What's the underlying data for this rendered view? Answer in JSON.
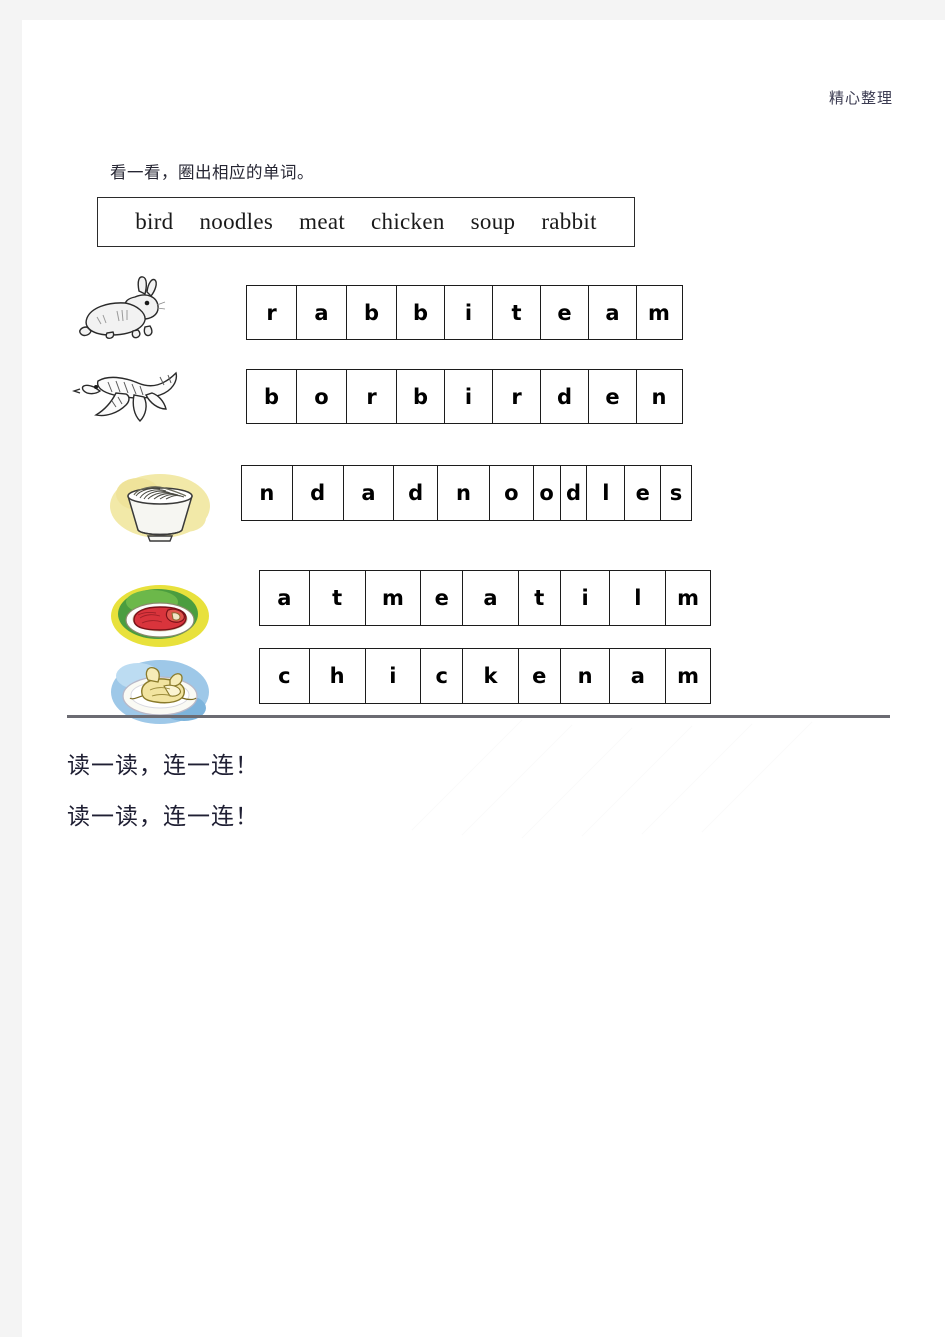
{
  "header": {
    "note": "精心整理"
  },
  "instruction": "看一看，圈出相应的单词。",
  "word_bank": {
    "words": [
      "bird",
      "noodles",
      "meat",
      "chicken",
      "soup",
      "rabbit"
    ]
  },
  "exercises": [
    {
      "picture": "rabbit-picture",
      "answer": "rabbit",
      "letters": [
        "r",
        "a",
        "b",
        "b",
        "i",
        "t",
        "e",
        "a",
        "m"
      ]
    },
    {
      "picture": "bird-picture",
      "answer": "bird",
      "letters": [
        "b",
        "o",
        "r",
        "b",
        "i",
        "r",
        "d",
        "e",
        "n"
      ]
    },
    {
      "picture": "noodles-picture",
      "answer": "noodles",
      "letters": [
        "n",
        "d",
        "a",
        "d",
        "n",
        "o",
        "o",
        "d",
        "l",
        "e",
        "s"
      ]
    },
    {
      "picture": "meat-picture",
      "answer": "meat",
      "letters": [
        "a",
        "t",
        "m",
        "e",
        "a",
        "t",
        "i",
        "l",
        "m"
      ]
    },
    {
      "picture": "chicken-picture",
      "answer": "chicken",
      "letters": [
        "c",
        "h",
        "i",
        "c",
        "k",
        "e",
        "n",
        "a",
        "m"
      ]
    }
  ],
  "prompts": [
    "读一读，连一连！",
    "读一读，连一连！"
  ],
  "colors": {
    "page_background": "#ffffff",
    "outer_background": "#f4f4f4",
    "text": "#1a1a1a",
    "header_note": "#3a3a50",
    "divider": "#6b6b72",
    "cell_border": "#1c1c1c"
  }
}
